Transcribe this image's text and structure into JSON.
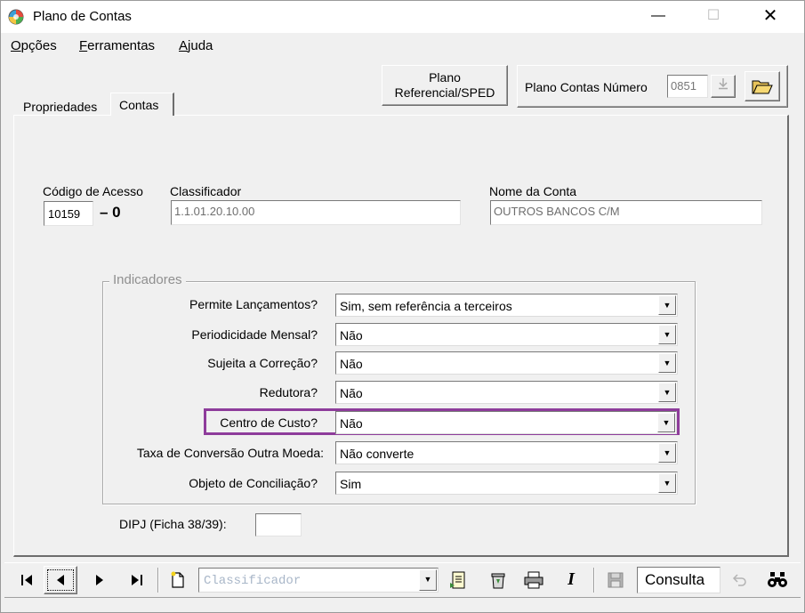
{
  "window": {
    "title": "Plano de Contas",
    "minimize_glyph": "—",
    "maximize_glyph": "☐",
    "close_glyph": "✕"
  },
  "menu": {
    "items": [
      {
        "underline": "O",
        "rest": "pções"
      },
      {
        "underline": "F",
        "rest": "erramentas"
      },
      {
        "underline": "A",
        "rest": "juda"
      }
    ]
  },
  "header": {
    "plano_button_line1": "Plano",
    "plano_button_line2": "Referencial/SPED",
    "plano_contas_label": "Plano Contas Número",
    "plano_contas_value": "0851"
  },
  "tabs": [
    {
      "label": "Propriedades"
    },
    {
      "label": "Contas"
    }
  ],
  "fields": {
    "codigo_label": "Código de Acesso",
    "codigo_value": "10159",
    "codigo_suffix": "– 0",
    "classificador_label": "Classificador",
    "classificador_value": "1.1.01.20.10.00",
    "nome_label": "Nome da Conta",
    "nome_value": "OUTROS BANCOS C/M"
  },
  "indicadores": {
    "title": "Indicadores",
    "rows": [
      {
        "label": "Permite Lançamentos?",
        "value": "Sim, sem referência a terceiros"
      },
      {
        "label": "Periodicidade Mensal?",
        "value": "Não"
      },
      {
        "label": "Sujeita a Correção?",
        "value": "Não"
      },
      {
        "label": "Redutora?",
        "value": "Não"
      },
      {
        "label": "Centro de Custo?",
        "value": "Não"
      },
      {
        "label": "Taxa de Conversão Outra Moeda:",
        "value": "Não converte"
      },
      {
        "label": "Objeto de Conciliação?",
        "value": "Sim"
      }
    ]
  },
  "dipj": {
    "label": "DIPJ (Ficha 38/39):",
    "value": ""
  },
  "toolbar": {
    "search_placeholder": "Classificador",
    "mode": "Consulta"
  },
  "colors": {
    "highlight": "#8e3c9b",
    "window_bg": "#f0f0f0"
  }
}
